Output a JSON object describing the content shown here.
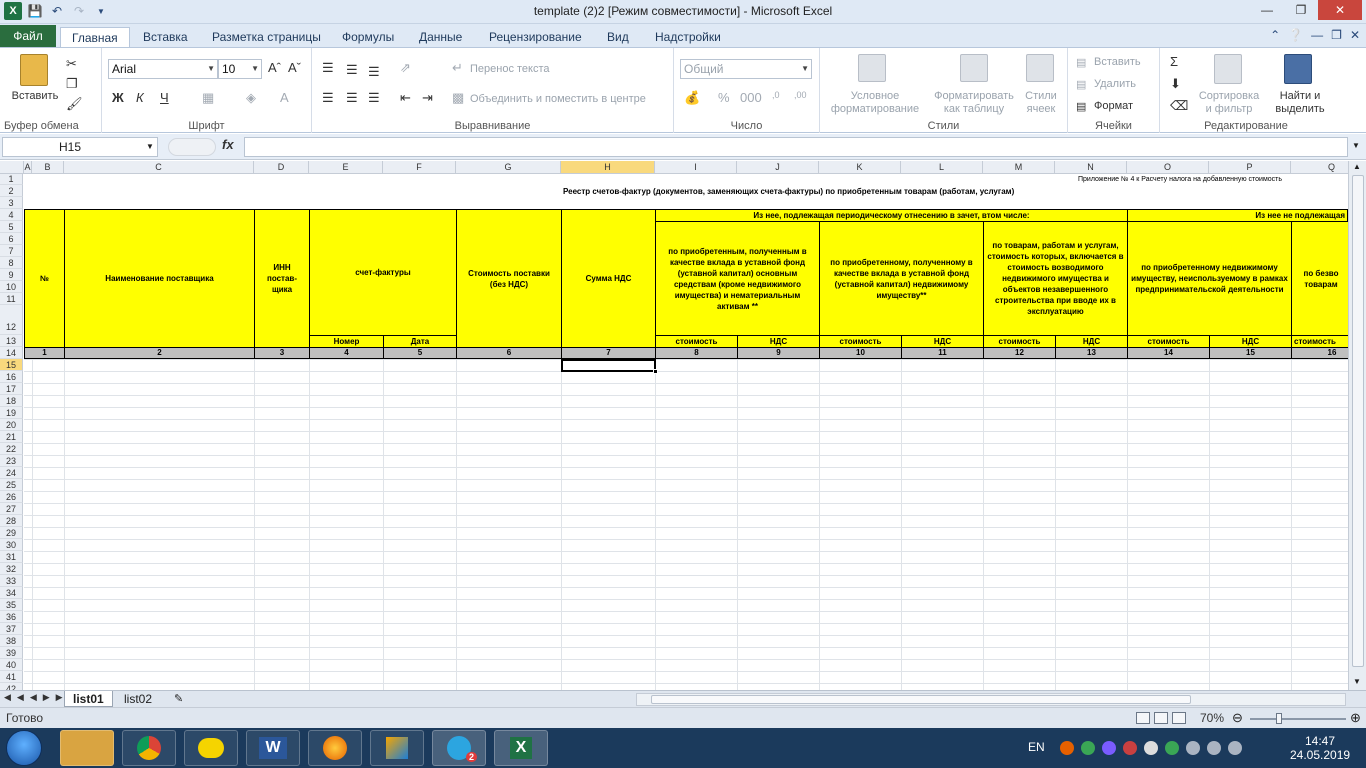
{
  "window": {
    "title": "template (2)2  [Режим совместимости]  -  Microsoft Excel",
    "app_icon_letter": "X"
  },
  "ribbon_tabs": [
    "Файл",
    "Главная",
    "Вставка",
    "Разметка страницы",
    "Формулы",
    "Данные",
    "Рецензирование",
    "Вид",
    "Надстройки"
  ],
  "ribbon": {
    "clipboard": {
      "paste_label": "Вставить",
      "group_label": "Буфер обмена"
    },
    "font": {
      "font_name": "Arial",
      "font_size": "10",
      "group_label": "Шрифт",
      "bold": "Ж",
      "italic": "К",
      "underline": "Ч"
    },
    "alignment": {
      "wrap_text": "Перенос текста",
      "merge_center": "Объединить и поместить в центре",
      "group_label": "Выравнивание"
    },
    "number": {
      "format": "Общий",
      "group_label": "Число"
    },
    "styles": {
      "conditional_formatting": "Условное форматирование",
      "format_as_table": "Форматировать как таблицу",
      "cell_styles": "Стили ячеек",
      "group_label": "Стили"
    },
    "cells": {
      "insert": "Вставить",
      "delete": "Удалить",
      "format": "Формат",
      "group_label": "Ячейки"
    },
    "editing": {
      "sort_filter": "Сортировка и фильтр",
      "find_select": "Найти и выделить",
      "group_label": "Редактирование"
    }
  },
  "formula_bar": {
    "name_box": "H15",
    "fx_label": "fx",
    "value": ""
  },
  "columns": [
    "A",
    "B",
    "C",
    "D",
    "E",
    "F",
    "G",
    "H",
    "I",
    "J",
    "K",
    "L",
    "M",
    "N",
    "O",
    "P",
    "Q"
  ],
  "rows": [
    "1",
    "2",
    "3",
    "4",
    "5",
    "6",
    "7",
    "8",
    "9",
    "10",
    "11",
    "12",
    "13",
    "14",
    "15",
    "16",
    "17",
    "18",
    "19",
    "20",
    "21",
    "22",
    "23",
    "24",
    "25",
    "26",
    "27",
    "28",
    "29",
    "30",
    "31",
    "32",
    "33",
    "34",
    "35",
    "36",
    "37",
    "38",
    "39",
    "40",
    "41",
    "42"
  ],
  "selected_cell": "H15",
  "sheet": {
    "appendix_note": "Приложение № 4 к Расчету  налога на добавленную стоимость",
    "table_title": "Реестр счетов-фактур (документов, заменяющих счета-фактуры) по приобретенным товарам (работам, услугам)",
    "headers": {
      "num": "№",
      "supplier": "Наименование поставщика",
      "inn": "ИНН постав-щика",
      "invoice": "счет-фактуры",
      "invoice_number": "Номер",
      "invoice_date": "Дата",
      "cost": "Стоимость поставки (без НДС)",
      "vat_sum": "Сумма НДС",
      "group1": "Из нее, подлежащая периодическому отнесению в зачет, втом числе:",
      "group2": "Из нее не подлежащая",
      "sub_fixed_assets": "по приобретенным, полученным в качестве вклада в уставной фонд (уставной капитал) основным средствам (кроме недвижимого имущества) и нематериальным активам **",
      "sub_real_estate": "по приобретенному, полученному в качестве вклада в уставной фонд (уставной капитал) недвижимому имуществу**",
      "sub_goods_works": "по товарам, работам и услугам, стоимость которых, включается в стоимость возводимого недвижимого имущества и объектов незавершенного строительства при вводе их в эксплуатацию",
      "sub_unused_property": "по приобретенному недвижимому имуществу, неиспользуемому в рамках предпринимательской деятельности",
      "sub_free": "по безво товарам",
      "cost_label": "стоимость",
      "vat_label": "НДС"
    },
    "column_numbers": [
      "1",
      "2",
      "3",
      "4",
      "5",
      "6",
      "7",
      "8",
      "9",
      "10",
      "11",
      "12",
      "13",
      "14",
      "15",
      "16"
    ]
  },
  "sheet_tabs": [
    "list01",
    "list02"
  ],
  "status": {
    "ready": "Готово",
    "zoom": "70%"
  },
  "taskbar": {
    "lang": "EN",
    "time": "14:47",
    "date": "24.05.2019",
    "apps": [
      "explorer",
      "chrome",
      "batman",
      "word",
      "firefox",
      "sketch",
      "telegram",
      "excel"
    ],
    "word_letter": "W",
    "excel_letter": "X",
    "telegram_badge": "2"
  },
  "colors": {
    "header_yellow": "#ffff00",
    "number_row_gray": "#bfbfbf",
    "file_tab_green": "#2a6d3e",
    "taskbar": "#1b3a5c"
  }
}
